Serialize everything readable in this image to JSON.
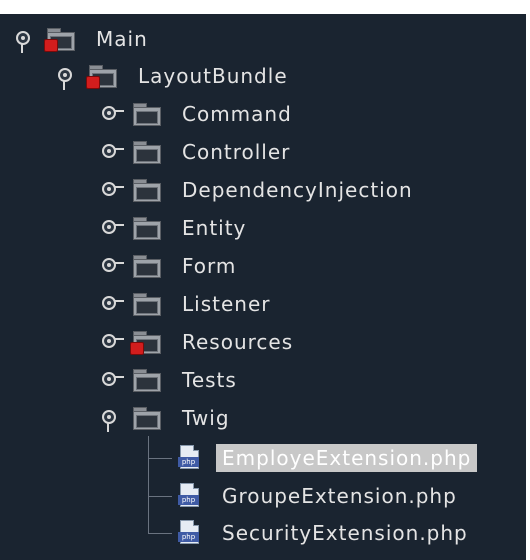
{
  "tree": {
    "root": {
      "label": "Main",
      "icon": "folder-error-icon",
      "expanded": true
    },
    "bundle": {
      "label": "LayoutBundle",
      "icon": "folder-error-icon",
      "expanded": true
    },
    "folders": [
      {
        "label": "Command",
        "icon": "folder-icon",
        "expanded": false
      },
      {
        "label": "Controller",
        "icon": "folder-icon",
        "expanded": false
      },
      {
        "label": "DependencyInjection",
        "icon": "folder-icon",
        "expanded": false
      },
      {
        "label": "Entity",
        "icon": "folder-icon",
        "expanded": false
      },
      {
        "label": "Form",
        "icon": "folder-icon",
        "expanded": false
      },
      {
        "label": "Listener",
        "icon": "folder-icon",
        "expanded": false
      },
      {
        "label": "Resources",
        "icon": "folder-error-icon",
        "expanded": false
      },
      {
        "label": "Tests",
        "icon": "folder-icon",
        "expanded": false
      },
      {
        "label": "Twig",
        "icon": "folder-icon",
        "expanded": true
      }
    ],
    "files": [
      {
        "label": "EmployeExtension.php",
        "icon": "php-file-icon",
        "selected": true
      },
      {
        "label": "GroupeExtension.php",
        "icon": "php-file-icon",
        "selected": false
      },
      {
        "label": "SecurityExtension.php",
        "icon": "php-file-icon",
        "selected": false
      }
    ],
    "php_tag": "php"
  },
  "colors": {
    "background": "#1a2430",
    "text": "#e4e4e4",
    "selection": "#c8c8c8",
    "error_badge": "#d21d1d"
  }
}
